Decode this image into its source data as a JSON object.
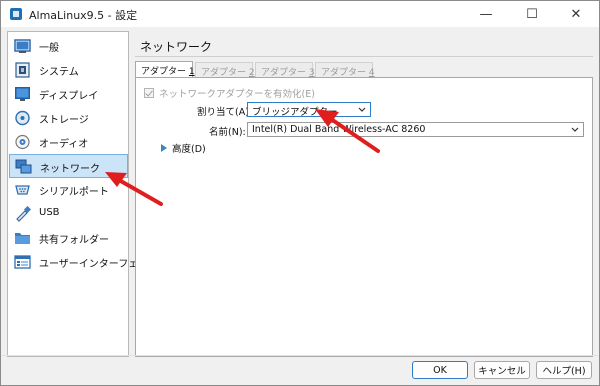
{
  "window": {
    "title": "AlmaLinux9.5 - 設定",
    "controls": {
      "minimize": "—",
      "maximize": "☐",
      "close": "✕"
    }
  },
  "sidebar": {
    "items": [
      {
        "label": "一般",
        "icon": "general-icon"
      },
      {
        "label": "システム",
        "icon": "system-icon"
      },
      {
        "label": "ディスプレイ",
        "icon": "display-icon"
      },
      {
        "label": "ストレージ",
        "icon": "storage-icon"
      },
      {
        "label": "オーディオ",
        "icon": "audio-icon"
      },
      {
        "label": "ネットワーク",
        "icon": "network-icon",
        "selected": true
      },
      {
        "label": "シリアルポート",
        "icon": "serial-port-icon"
      },
      {
        "label": "USB",
        "icon": "usb-icon"
      },
      {
        "label": "共有フォルダー",
        "icon": "shared-folder-icon"
      },
      {
        "label": "ユーザーインターフェース",
        "icon": "user-interface-icon"
      }
    ]
  },
  "panel": {
    "title": "ネットワーク",
    "tabs": [
      {
        "label": "アダプター ",
        "num": "1",
        "active": true
      },
      {
        "label": "アダプター ",
        "num": "2"
      },
      {
        "label": "アダプター ",
        "num": "3"
      },
      {
        "label": "アダプター ",
        "num": "4"
      }
    ],
    "enable_adapter_label": "ネットワークアダプターを有効化(E)",
    "attached_to": {
      "label": "割り当て(A):",
      "value": "ブリッジアダプター"
    },
    "name": {
      "label": "名前(N):",
      "value": "Intel(R) Dual Band Wireless-AC 8260"
    },
    "advanced_label": "高度(D)"
  },
  "buttons": {
    "ok": "OK",
    "cancel": "キャンセル",
    "help": "ヘルプ(H)"
  },
  "colors": {
    "accent": "#2f7dc8",
    "selection": "#cce4f7",
    "annotation_arrow": "#e01e1e"
  }
}
